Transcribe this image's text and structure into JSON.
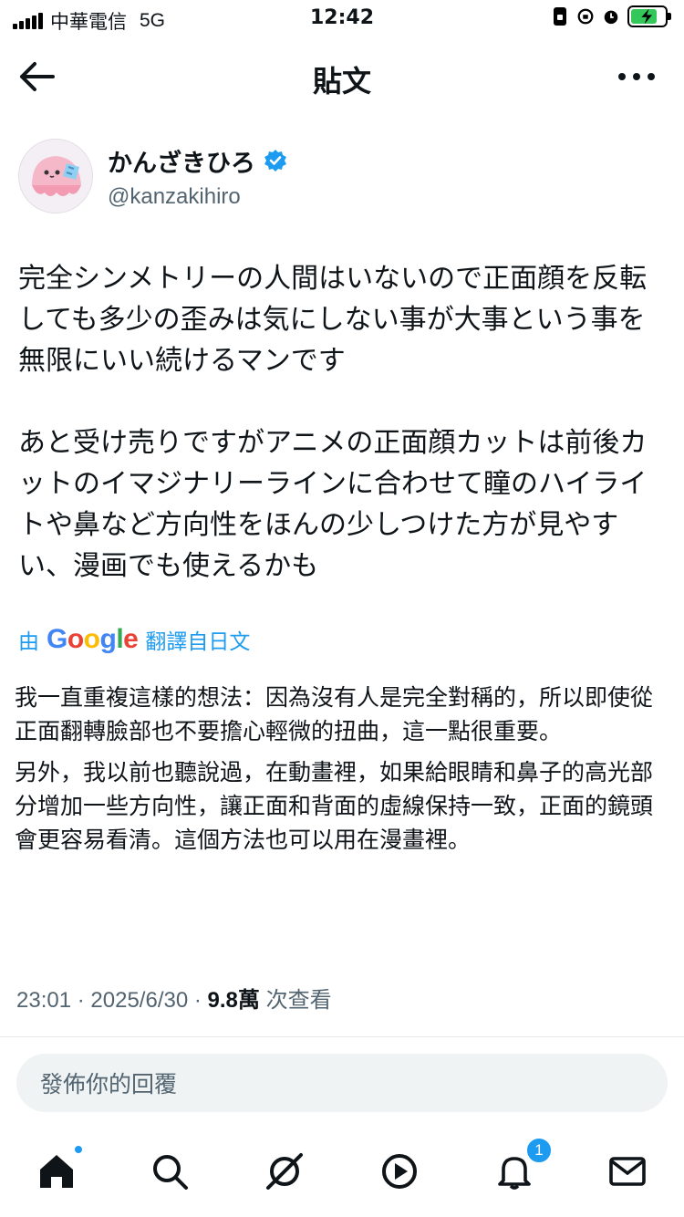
{
  "status_bar": {
    "carrier": "中華電信",
    "network": "5G",
    "time": "12:42"
  },
  "header": {
    "title": "貼文"
  },
  "author": {
    "display_name": "かんざきひろ",
    "handle": "@kanzakihiro",
    "verified": true
  },
  "tweet": {
    "paragraphs": [
      "完全シンメトリーの人間はいないので正面顔を反転しても多少の歪みは気にしない事が大事という事を無限にいい続けるマンです",
      "あと受け売りですがアニメの正面顔カットは前後カットのイマジナリーラインに合わせて瞳のハイライトや鼻など方向性をほんの少しつけた方が見やすい、漫画でも使えるかも"
    ]
  },
  "translation": {
    "prefix": "由",
    "brand": "Google",
    "label": "翻譯自日文",
    "paragraphs": [
      "我一直重複這樣的想法：因為沒有人是完全對稱的，所以即使從正面翻轉臉部也不要擔心輕微的扭曲，這一點很重要。",
      "另外，我以前也聽說過，在動畫裡，如果給眼睛和鼻子的高光部分增加一些方向性，讓正面和背面的虛線保持一致，正面的鏡頭會更容易看清。這個方法也可以用在漫畫裡。"
    ]
  },
  "meta": {
    "time": "23:01",
    "date": "2025/6/30",
    "views": "9.8萬",
    "views_label": "次查看",
    "separator": "·"
  },
  "reply": {
    "placeholder": "發佈你的回覆"
  },
  "tabbar": {
    "notifications_badge": "1",
    "icons": [
      "home-icon",
      "search-icon",
      "grok-icon",
      "video-icon",
      "bell-icon",
      "mail-icon"
    ]
  },
  "colors": {
    "accent": "#1d9bf0",
    "text": "#0f1419",
    "secondary": "#536471",
    "battery": "#34c759"
  }
}
